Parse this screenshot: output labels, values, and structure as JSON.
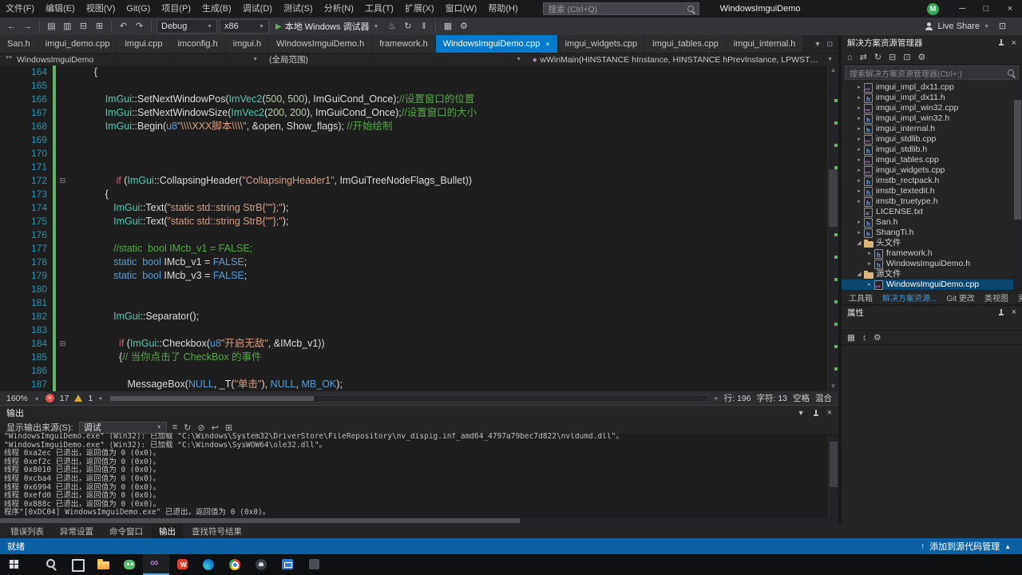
{
  "title_bar": {
    "menus": [
      "文件(F)",
      "编辑(E)",
      "视图(V)",
      "Git(G)",
      "项目(P)",
      "生成(B)",
      "调试(D)",
      "测试(S)",
      "分析(N)",
      "工具(T)",
      "扩展(X)",
      "窗口(W)",
      "帮助(H)"
    ],
    "search_placeholder": "搜索 (Ctrl+Q)",
    "window_title": "WindowsImguiDemo",
    "account_initial": "M"
  },
  "toolbar": {
    "config": "Debug",
    "platform": "x86",
    "run_label": "本地 Windows 调试器",
    "live_share": "Live Share"
  },
  "tabs": [
    {
      "label": "San.h"
    },
    {
      "label": "imgui_demo.cpp"
    },
    {
      "label": "imgui.cpp"
    },
    {
      "label": "imconfig.h"
    },
    {
      "label": "imgui.h"
    },
    {
      "label": "WindowsImguiDemo.h"
    },
    {
      "label": "framework.h"
    },
    {
      "label": "WindowsImguiDemo.cpp",
      "active": true
    },
    {
      "label": "imgui_widgets.cpp"
    },
    {
      "label": "imgui_tables.cpp"
    },
    {
      "label": "imgui_internal.h"
    }
  ],
  "breadcrumb": {
    "project": "WindowsImguiDemo",
    "scope": "(全局范围)",
    "member": "wWinMain(HINSTANCE hInstance, HINSTANCE hPrevInstance, LPWSTR lpCmdLine,"
  },
  "editor": {
    "lines": [
      {
        "n": 164,
        "segs": [
          [
            "p",
            "        {"
          ]
        ]
      },
      {
        "n": 165,
        "segs": []
      },
      {
        "n": 166,
        "segs": [
          [
            "p",
            "            "
          ],
          [
            "t",
            "ImGui"
          ],
          [
            "p",
            "::"
          ],
          [
            "f",
            "SetNextWindowPos"
          ],
          [
            "p",
            "("
          ],
          [
            "t",
            "ImVec2"
          ],
          [
            "p",
            "("
          ],
          [
            "n",
            "500"
          ],
          [
            "p",
            ", "
          ],
          [
            "n",
            "500"
          ],
          [
            "p",
            "), ImGuiCond_Once);"
          ],
          [
            "cm",
            "//设置窗口的位置"
          ]
        ]
      },
      {
        "n": 167,
        "segs": [
          [
            "p",
            "            "
          ],
          [
            "t",
            "ImGui"
          ],
          [
            "p",
            "::"
          ],
          [
            "f",
            "SetNextWindowSize"
          ],
          [
            "p",
            "("
          ],
          [
            "t",
            "ImVec2"
          ],
          [
            "p",
            "("
          ],
          [
            "n",
            "200"
          ],
          [
            "p",
            ", "
          ],
          [
            "n",
            "200"
          ],
          [
            "p",
            "), ImGuiCond_Once);"
          ],
          [
            "cm",
            "//设置窗口的大小"
          ]
        ]
      },
      {
        "n": 168,
        "segs": [
          [
            "p",
            "            "
          ],
          [
            "t",
            "ImGui"
          ],
          [
            "p",
            "::"
          ],
          [
            "f",
            "Begin"
          ],
          [
            "p",
            "("
          ],
          [
            "k",
            "u8"
          ],
          [
            "s",
            "\"\\\\\\\\XXX脚本\\\\\\\\\""
          ],
          [
            "p",
            ", &open, Show_flags); "
          ],
          [
            "cm",
            "//开始绘制"
          ]
        ]
      },
      {
        "n": 169,
        "segs": []
      },
      {
        "n": 170,
        "segs": []
      },
      {
        "n": 171,
        "segs": []
      },
      {
        "n": 172,
        "fold": true,
        "segs": [
          [
            "p",
            "                "
          ],
          [
            "c",
            "if"
          ],
          [
            "p",
            " ("
          ],
          [
            "t",
            "ImGui"
          ],
          [
            "p",
            "::"
          ],
          [
            "f",
            "CollapsingHeader"
          ],
          [
            "p",
            "("
          ],
          [
            "s",
            "\"CollapsingHeader1\""
          ],
          [
            "p",
            ", ImGuiTreeNodeFlags_Bullet))"
          ]
        ]
      },
      {
        "n": 173,
        "segs": [
          [
            "p",
            "            {"
          ]
        ]
      },
      {
        "n": 174,
        "segs": [
          [
            "p",
            "               "
          ],
          [
            "t",
            "ImGui"
          ],
          [
            "p",
            "::"
          ],
          [
            "f",
            "Text"
          ],
          [
            "p",
            "("
          ],
          [
            "s",
            "\"static std::string StrB{\"\"};\""
          ],
          [
            "p",
            ");"
          ]
        ]
      },
      {
        "n": 175,
        "segs": [
          [
            "p",
            "               "
          ],
          [
            "t",
            "ImGui"
          ],
          [
            "p",
            "::"
          ],
          [
            "f",
            "Text"
          ],
          [
            "p",
            "("
          ],
          [
            "s",
            "\"static std::string StrB{\"\"};\""
          ],
          [
            "p",
            ");"
          ]
        ]
      },
      {
        "n": 176,
        "segs": []
      },
      {
        "n": 177,
        "segs": [
          [
            "p",
            "               "
          ],
          [
            "cm",
            "//static  bool IMcb_v1 = FALSE;"
          ]
        ]
      },
      {
        "n": 178,
        "segs": [
          [
            "p",
            "               "
          ],
          [
            "k",
            "static"
          ],
          [
            "p",
            "  "
          ],
          [
            "k",
            "bool"
          ],
          [
            "p",
            " IMcb_v1 = "
          ],
          [
            "k",
            "FALSE"
          ],
          [
            "p",
            ";"
          ]
        ]
      },
      {
        "n": 179,
        "segs": [
          [
            "p",
            "               "
          ],
          [
            "k",
            "static"
          ],
          [
            "p",
            "  "
          ],
          [
            "k",
            "bool"
          ],
          [
            "p",
            " IMcb_v3 = "
          ],
          [
            "k",
            "FALSE"
          ],
          [
            "p",
            ";"
          ]
        ]
      },
      {
        "n": 180,
        "segs": []
      },
      {
        "n": 181,
        "segs": []
      },
      {
        "n": 182,
        "segs": [
          [
            "p",
            "               "
          ],
          [
            "t",
            "ImGui"
          ],
          [
            "p",
            "::"
          ],
          [
            "f",
            "Separator"
          ],
          [
            "p",
            "();"
          ]
        ]
      },
      {
        "n": 183,
        "segs": []
      },
      {
        "n": 184,
        "fold": true,
        "segs": [
          [
            "p",
            "                 "
          ],
          [
            "c",
            "if"
          ],
          [
            "p",
            " ("
          ],
          [
            "t",
            "ImGui"
          ],
          [
            "p",
            "::"
          ],
          [
            "f",
            "Checkbox"
          ],
          [
            "p",
            "("
          ],
          [
            "k",
            "u8"
          ],
          [
            "s",
            "\"开启无敌\""
          ],
          [
            "p",
            ", &IMcb_v1))"
          ]
        ]
      },
      {
        "n": 185,
        "segs": [
          [
            "p",
            "                 {"
          ],
          [
            "cm",
            "// 当你点击了 CheckBox 的事件"
          ]
        ]
      },
      {
        "n": 186,
        "segs": []
      },
      {
        "n": 187,
        "segs": [
          [
            "p",
            "                    "
          ],
          [
            "f",
            "MessageBox"
          ],
          [
            "p",
            "("
          ],
          [
            "k",
            "NULL"
          ],
          [
            "p",
            ", "
          ],
          [
            "f",
            "_T"
          ],
          [
            "p",
            "("
          ],
          [
            "s",
            "\"单击\""
          ],
          [
            "p",
            "), "
          ],
          [
            "k",
            "NULL"
          ],
          [
            "p",
            ", "
          ],
          [
            "k",
            "MB_OK"
          ],
          [
            "p",
            ");"
          ]
        ]
      }
    ],
    "status": {
      "zoom": "160%",
      "errors": "17",
      "warnings": "1",
      "line": "行: 196",
      "column": "字符: 13",
      "spaces": "空格",
      "line_endings": "混合"
    }
  },
  "solution_explorer": {
    "title": "解决方案资源管理器",
    "search_placeholder": "搜索解决方案资源管理器(Ctrl+;)",
    "items": [
      {
        "label": "imgui_impl_dx11.cpp",
        "icon": "cpp",
        "depth": 1,
        "arrow": true
      },
      {
        "label": "imgui_impl_dx11.h",
        "icon": "h",
        "depth": 1,
        "arrow": true
      },
      {
        "label": "imgui_impl_win32.cpp",
        "icon": "cpp",
        "depth": 1,
        "arrow": true
      },
      {
        "label": "imgui_impl_win32.h",
        "icon": "h",
        "depth": 1,
        "arrow": true
      },
      {
        "label": "imgui_internal.h",
        "icon": "h",
        "depth": 1,
        "arrow": true
      },
      {
        "label": "imgui_stdlib.cpp",
        "icon": "cpp",
        "depth": 1,
        "arrow": true
      },
      {
        "label": "imgui_stdlib.h",
        "icon": "h",
        "depth": 1,
        "arrow": true
      },
      {
        "label": "imgui_tables.cpp",
        "icon": "cpp",
        "depth": 1,
        "arrow": true
      },
      {
        "label": "imgui_widgets.cpp",
        "icon": "cpp",
        "depth": 1,
        "arrow": true
      },
      {
        "label": "imstb_rectpack.h",
        "icon": "h",
        "depth": 1,
        "arrow": true
      },
      {
        "label": "imstb_textedit.h",
        "icon": "h",
        "depth": 1,
        "arrow": true
      },
      {
        "label": "imstb_truetype.h",
        "icon": "h",
        "depth": 1,
        "arrow": true
      },
      {
        "label": "LICENSE.txt",
        "icon": "txt",
        "depth": 1,
        "arrow": false
      },
      {
        "label": "San.h",
        "icon": "h",
        "depth": 1,
        "arrow": true
      },
      {
        "label": "ShangTi.h",
        "icon": "h",
        "depth": 1,
        "arrow": true
      },
      {
        "label": "头文件",
        "icon": "folder",
        "depth": 1,
        "open": true
      },
      {
        "label": "framework.h",
        "icon": "h",
        "depth": 2,
        "arrow": true
      },
      {
        "label": "WindowsImguiDemo.h",
        "icon": "h",
        "depth": 2,
        "arrow": true
      },
      {
        "label": "源文件",
        "icon": "folder",
        "depth": 1,
        "open": true
      },
      {
        "label": "WindowsImguiDemo.cpp",
        "icon": "cpp",
        "depth": 2,
        "arrow": true,
        "selected": true
      }
    ],
    "tabs": [
      "工具箱",
      "解决方案资源...",
      "Git 更改",
      "类视图",
      "资源视图"
    ]
  },
  "properties": {
    "title": "属性"
  },
  "output": {
    "title": "输出",
    "source_label": "显示输出来源(S):",
    "source_value": "调试",
    "lines": [
      "\"WindowsImguiDemo.exe\" (Win32): 已加载 \"C:\\Windows\\System32\\DriverStore\\FileRepository\\nv_dispig.inf_amd64_4797a79bec7d822\\nvldumd.dll\"。",
      "\"WindowsImguiDemo.exe\" (Win32): 已加载 \"C:\\Windows\\SysWOW64\\ole32.dll\"。",
      "线程 0xa2ec 已退出，返回值为 0 (0x0)。",
      "线程 0xef2c 已退出，返回值为 0 (0x0)。",
      "线程 0x8010 已退出，返回值为 0 (0x0)。",
      "线程 0xcba4 已退出，返回值为 0 (0x0)。",
      "线程 0x6994 已退出，返回值为 0 (0x0)。",
      "线程 0xefd0 已退出，返回值为 0 (0x0)。",
      "线程 0x888c 已退出，返回值为 0 (0x0)。",
      "程序\"[0xDC04] WindowsImguiDemo.exe\" 已退出，返回值为 0 (0x0)。"
    ]
  },
  "bottom_tabs": [
    "错误列表",
    "异常设置",
    "命令窗口",
    "输出",
    "查找符号结果"
  ],
  "status_bar": {
    "ready": "就绪",
    "source_control": "添加到源代码管理"
  },
  "taskbar": {
    "items": [
      {
        "name": "start"
      },
      {
        "name": "search"
      },
      {
        "name": "task-view"
      },
      {
        "name": "file-explorer"
      },
      {
        "name": "wechat"
      },
      {
        "name": "visual-studio",
        "active": true
      },
      {
        "name": "wps"
      },
      {
        "name": "edge"
      },
      {
        "name": "chrome"
      },
      {
        "name": "github-desktop"
      },
      {
        "name": "mail-app"
      },
      {
        "name": "dev-app"
      }
    ]
  }
}
